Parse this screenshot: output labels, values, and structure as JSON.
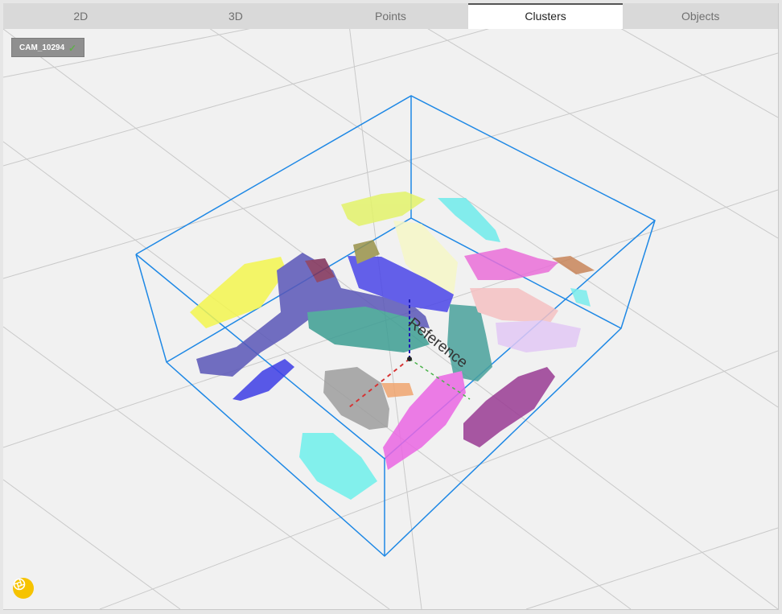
{
  "tabs": [
    {
      "label": "2D",
      "active": false
    },
    {
      "label": "3D",
      "active": false
    },
    {
      "label": "Points",
      "active": false
    },
    {
      "label": "Clusters",
      "active": true
    },
    {
      "label": "Objects",
      "active": false
    }
  ],
  "camera_badge": {
    "label": "CAM_10294",
    "status_icon": "check-icon"
  },
  "reference_label": "Reference",
  "snapshot_button": {
    "icon": "aperture-icon"
  },
  "colors": {
    "bounding_box": "#1e88e5",
    "accent_yellow": "#f6c300",
    "active_tab_border": "#555555"
  }
}
